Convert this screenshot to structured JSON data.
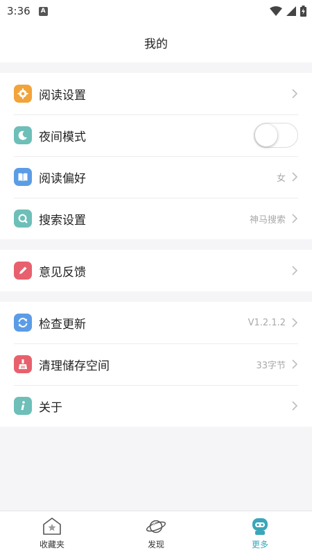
{
  "status_bar": {
    "time": "3:36",
    "notification_icon": "A"
  },
  "header": {
    "title": "我的"
  },
  "sections": [
    {
      "items": [
        {
          "label": "阅读设置",
          "icon": "gear-icon",
          "color": "#f2a33a"
        },
        {
          "label": "夜间模式",
          "icon": "moon-icon",
          "color": "#6dbfb8",
          "toggle": false
        },
        {
          "label": "阅读偏好",
          "icon": "book-icon",
          "color": "#5b9ce6",
          "value": "女"
        },
        {
          "label": "搜索设置",
          "icon": "search-icon",
          "color": "#6dbfb8",
          "value": "神马搜索"
        }
      ]
    },
    {
      "items": [
        {
          "label": "意见反馈",
          "icon": "pencil-icon",
          "color": "#e8606d"
        }
      ]
    },
    {
      "items": [
        {
          "label": "检查更新",
          "icon": "refresh-icon",
          "color": "#5b9ce6",
          "value": "V1.2.1.2"
        },
        {
          "label": "清理储存空间",
          "icon": "broom-icon",
          "color": "#e8606d",
          "value": "33字节"
        },
        {
          "label": "关于",
          "icon": "info-icon",
          "color": "#6dbfb8"
        }
      ]
    }
  ],
  "bottom_nav": [
    {
      "label": "收藏夹",
      "icon": "bookmark-star-icon",
      "active": false
    },
    {
      "label": "发现",
      "icon": "planet-icon",
      "active": false
    },
    {
      "label": "更多",
      "icon": "robot-icon",
      "active": true,
      "color": "#3aa6b9"
    }
  ]
}
